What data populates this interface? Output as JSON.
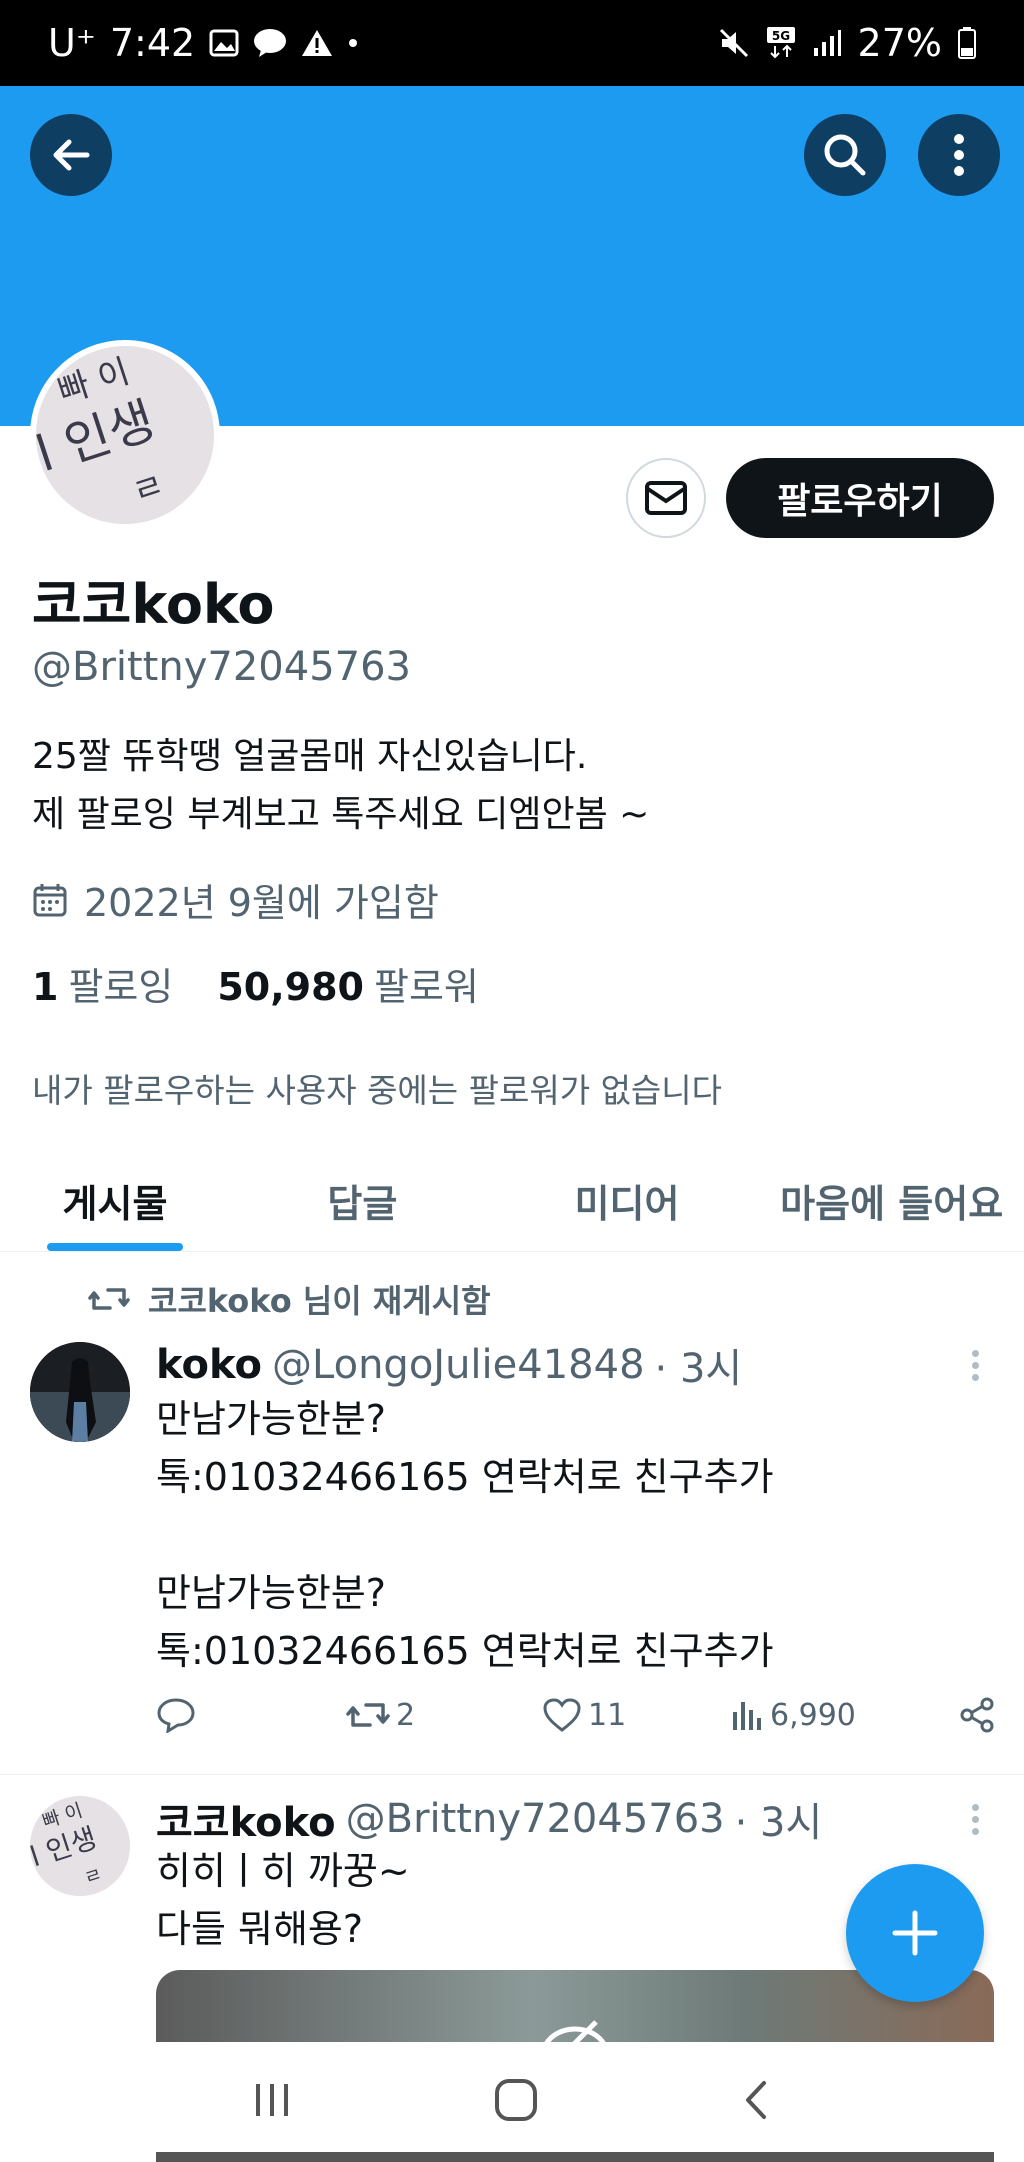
{
  "status_bar": {
    "carrier": "U⁺",
    "time": "7:42",
    "battery": "27%"
  },
  "header": {
    "back_icon": "arrow-left-icon",
    "search_icon": "search-icon",
    "more_icon": "more-vertical-icon",
    "banner_color": "#1d9bf0"
  },
  "profile": {
    "display_name": "코코koko",
    "handle": "@Brittny72045763",
    "follow_label": "팔로우하기",
    "bio_line1": "25짤 뜌학땡 얼굴몸매 자신있습니다.",
    "bio_line2": "제 팔로잉 부계보고 톡주세요 디엠안봄 ~",
    "joined": "2022년 9월에 가입함",
    "following_count": "1",
    "following_label": "팔로잉",
    "followers_count": "50,980",
    "followers_label": "팔로워",
    "mutual_note": "내가 팔로우하는 사용자 중에는 팔로워가 없습니다"
  },
  "tabs": [
    {
      "label": "게시물",
      "active": true
    },
    {
      "label": "답글",
      "active": false
    },
    {
      "label": "미디어",
      "active": false
    },
    {
      "label": "마음에 들어요",
      "active": false
    }
  ],
  "tweets": [
    {
      "repost_label": "코코koko 님이 재게시함",
      "name": "koko",
      "handle": "@LongoJulie41848",
      "time": "· 3시",
      "text": "만남가능한분?\n톡:01032466165 연락처로 친구추가\n\n만남가능한분?\n톡:01032466165 연락처로 친구추가",
      "reposts": "2",
      "likes": "11",
      "views": "6,990"
    },
    {
      "name": "코코koko",
      "handle": "@Brittny72045763",
      "time": "· 3시",
      "text": "히히ㅣ히 까꿍~\n다들 뭐해용?"
    }
  ],
  "avatar_text": {
    "line1": "빠 이",
    "line2": "l 인생",
    "line3": "ㄹ"
  },
  "accent_color": "#1d9bf0"
}
